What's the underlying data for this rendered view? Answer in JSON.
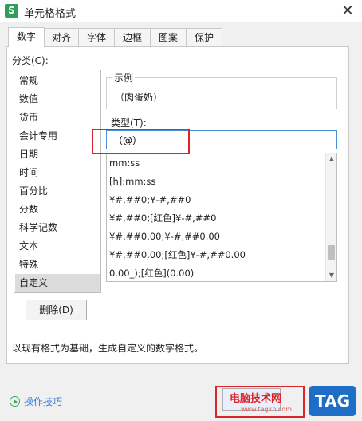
{
  "window": {
    "title": "单元格格式",
    "app_icon_letter": "S",
    "close_glyph": "✕"
  },
  "tabs": [
    {
      "label": "数字",
      "active": true
    },
    {
      "label": "对齐"
    },
    {
      "label": "字体"
    },
    {
      "label": "边框"
    },
    {
      "label": "图案"
    },
    {
      "label": "保护"
    }
  ],
  "category": {
    "label": "分类(C):",
    "items": [
      "常规",
      "数值",
      "货币",
      "会计专用",
      "日期",
      "时间",
      "百分比",
      "分数",
      "科学记数",
      "文本",
      "特殊",
      "自定义"
    ],
    "selected": "自定义"
  },
  "sample": {
    "label": "示例",
    "value": "（肉蛋奶）"
  },
  "type": {
    "label": "类型(T):",
    "value": "（@）",
    "options": [
      "mm:ss",
      "[h]:mm:ss",
      "¥#,##0;¥-#,##0",
      "¥#,##0;[红色]¥-#,##0",
      "¥#,##0.00;¥-#,##0.00",
      "¥#,##0.00;[红色]¥-#,##0.00",
      "0.00_);[红色](0.00)"
    ]
  },
  "scroll": {
    "up_glyph": "▲",
    "down_glyph": "▼"
  },
  "buttons": {
    "delete": "删除(D)"
  },
  "description": "以现有格式为基础，生成自定义的数字格式。",
  "footer": {
    "tips_label": "操作技巧"
  },
  "watermark": {
    "text": "电脑技术网",
    "url": "www.tagxp.com",
    "tag": "TAG"
  },
  "colors": {
    "highlight": "#d9262b",
    "accent": "#4a8fd6",
    "logo": "#2f9e5a"
  }
}
